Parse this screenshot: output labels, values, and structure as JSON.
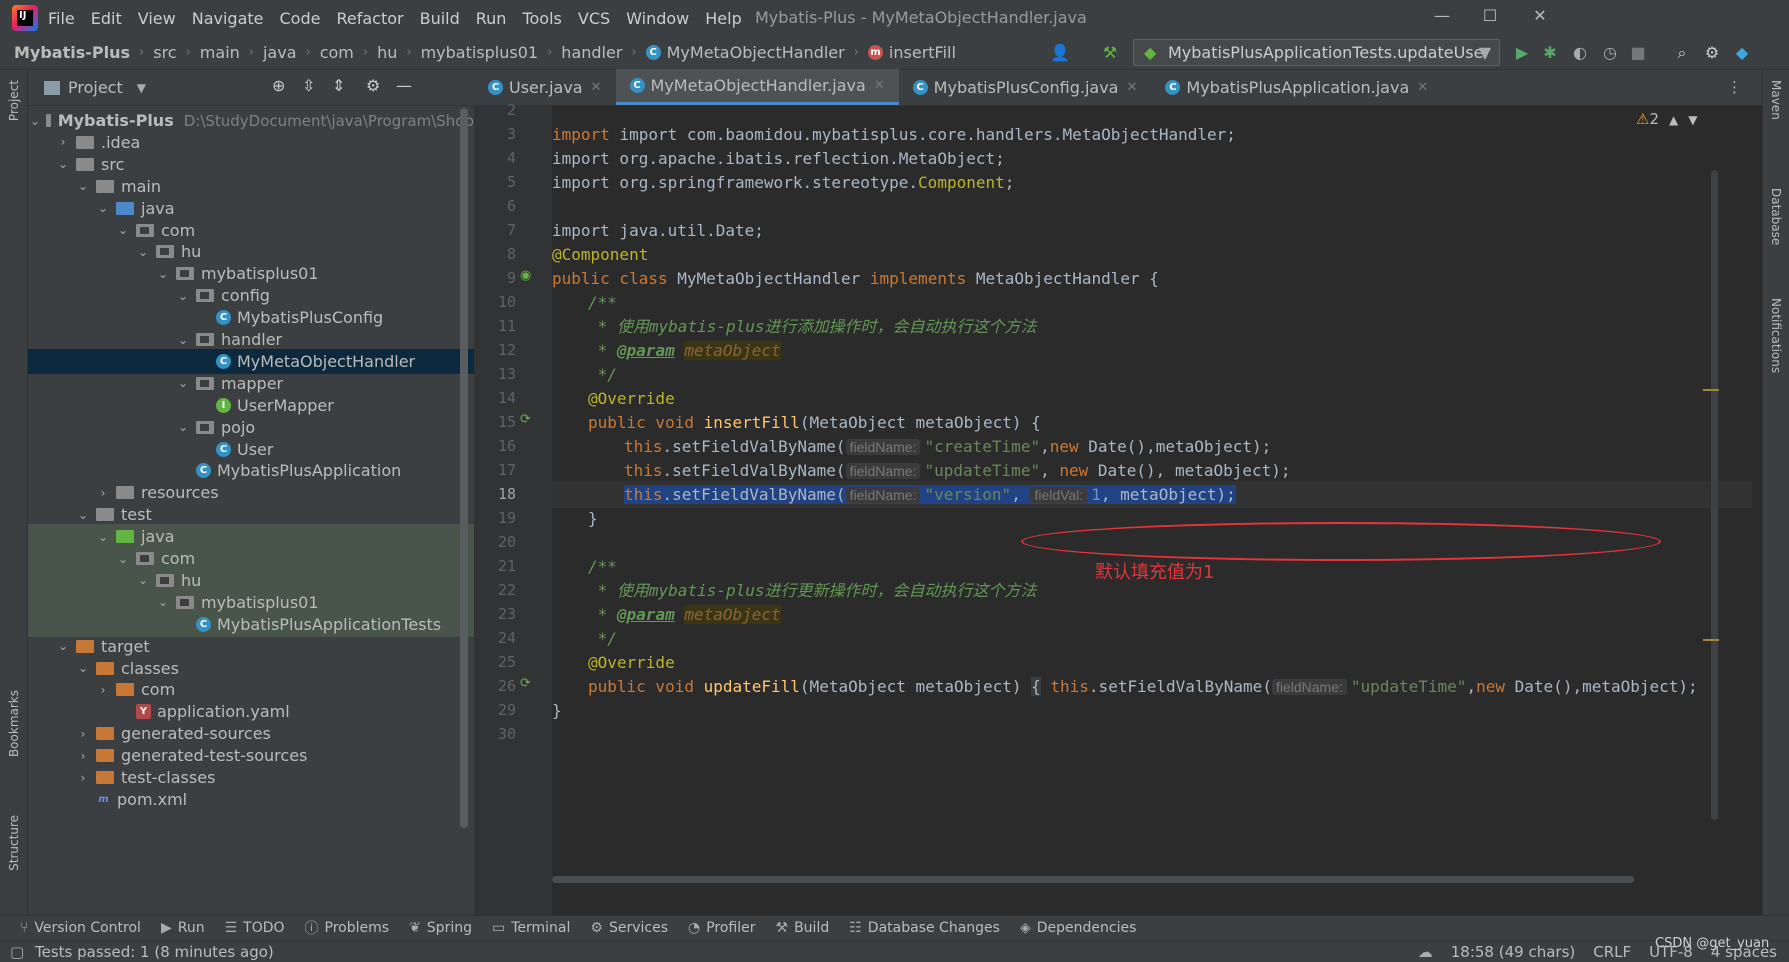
{
  "window": {
    "title": "Mybatis-Plus - MyMetaObjectHandler.java",
    "minimize": "—",
    "maximize": "☐",
    "close": "✕"
  },
  "menu": [
    "File",
    "Edit",
    "View",
    "Navigate",
    "Code",
    "Refactor",
    "Build",
    "Run",
    "Tools",
    "VCS",
    "Window",
    "Help"
  ],
  "breadcrumb": [
    "Mybatis-Plus",
    "src",
    "main",
    "java",
    "com",
    "hu",
    "mybatisplus01",
    "handler",
    "MyMetaObjectHandler",
    "insertFill"
  ],
  "run_config": "MybatisPlusApplicationTests.updateUser",
  "project_panel": {
    "title": "Project",
    "root_path": "D:\\StudyDocument\\java\\Program\\Shop"
  },
  "tree": [
    {
      "label": "Mybatis-Plus",
      "depth": 0,
      "arrow": "⌄",
      "icon": "fold gray",
      "bold": true
    },
    {
      "label": ".idea",
      "depth": 1,
      "arrow": "›",
      "icon": "fold gray"
    },
    {
      "label": "src",
      "depth": 1,
      "arrow": "⌄",
      "icon": "fold gray"
    },
    {
      "label": "main",
      "depth": 2,
      "arrow": "⌄",
      "icon": "fold gray"
    },
    {
      "label": "java",
      "depth": 3,
      "arrow": "⌄",
      "icon": "fold blue"
    },
    {
      "label": "com",
      "depth": 4,
      "arrow": "⌄",
      "icon": "fold gray pkg"
    },
    {
      "label": "hu",
      "depth": 5,
      "arrow": "⌄",
      "icon": "fold gray pkg"
    },
    {
      "label": "mybatisplus01",
      "depth": 6,
      "arrow": "⌄",
      "icon": "fold gray pkg"
    },
    {
      "label": "config",
      "depth": 7,
      "arrow": "⌄",
      "icon": "fold gray pkg"
    },
    {
      "label": "MybatisPlusConfig",
      "depth": 8,
      "arrow": "",
      "icon": "class"
    },
    {
      "label": "handler",
      "depth": 7,
      "arrow": "⌄",
      "icon": "fold gray pkg"
    },
    {
      "label": "MyMetaObjectHandler",
      "depth": 8,
      "arrow": "",
      "icon": "class",
      "selected": true
    },
    {
      "label": "mapper",
      "depth": 7,
      "arrow": "⌄",
      "icon": "fold gray pkg"
    },
    {
      "label": "UserMapper",
      "depth": 8,
      "arrow": "",
      "icon": "interface"
    },
    {
      "label": "pojo",
      "depth": 7,
      "arrow": "⌄",
      "icon": "fold gray pkg"
    },
    {
      "label": "User",
      "depth": 8,
      "arrow": "",
      "icon": "class"
    },
    {
      "label": "MybatisPlusApplication",
      "depth": 7,
      "arrow": "",
      "icon": "class"
    },
    {
      "label": "resources",
      "depth": 3,
      "arrow": "›",
      "icon": "fold gray"
    },
    {
      "label": "test",
      "depth": 2,
      "arrow": "⌄",
      "icon": "fold gray"
    },
    {
      "label": "java",
      "depth": 3,
      "arrow": "⌄",
      "icon": "fold green",
      "test": true
    },
    {
      "label": "com",
      "depth": 4,
      "arrow": "⌄",
      "icon": "fold gray pkg",
      "test": true
    },
    {
      "label": "hu",
      "depth": 5,
      "arrow": "⌄",
      "icon": "fold gray pkg",
      "test": true
    },
    {
      "label": "mybatisplus01",
      "depth": 6,
      "arrow": "⌄",
      "icon": "fold gray pkg",
      "test": true
    },
    {
      "label": "MybatisPlusApplicationTests",
      "depth": 7,
      "arrow": "",
      "icon": "class",
      "test": true
    },
    {
      "label": "target",
      "depth": 1,
      "arrow": "⌄",
      "icon": "fold orange"
    },
    {
      "label": "classes",
      "depth": 2,
      "arrow": "⌄",
      "icon": "fold orange"
    },
    {
      "label": "com",
      "depth": 3,
      "arrow": "›",
      "icon": "fold orange"
    },
    {
      "label": "application.yaml",
      "depth": 4,
      "arrow": "",
      "icon": "yaml"
    },
    {
      "label": "generated-sources",
      "depth": 2,
      "arrow": "›",
      "icon": "fold orange"
    },
    {
      "label": "generated-test-sources",
      "depth": 2,
      "arrow": "›",
      "icon": "fold orange"
    },
    {
      "label": "test-classes",
      "depth": 2,
      "arrow": "›",
      "icon": "fold orange"
    },
    {
      "label": "pom.xml",
      "depth": 2,
      "arrow": "",
      "icon": "maven"
    }
  ],
  "tabs": [
    {
      "label": "User.java",
      "active": false
    },
    {
      "label": "MyMetaObjectHandler.java",
      "active": true
    },
    {
      "label": "MybatisPlusConfig.java",
      "active": false
    },
    {
      "label": "MybatisPlusApplication.java",
      "active": false
    }
  ],
  "line_numbers": [
    "2",
    "3",
    "4",
    "5",
    "6",
    "7",
    "8",
    "9",
    "10",
    "11",
    "12",
    "13",
    "14",
    "15",
    "16",
    "17",
    "18",
    "19",
    "20",
    "21",
    "22",
    "23",
    "24",
    "25",
    "26",
    "29",
    "30"
  ],
  "current_line": "18",
  "code": {
    "l3": "import com.baomidou.mybatisplus.core.handlers.MetaObjectHandler;",
    "l4": "import org.apache.ibatis.reflection.MetaObject;",
    "l5a": "import org.springframework.stereotype.",
    "l5b": "Component",
    "l7": "import java.util.Date;",
    "l8": "@Component",
    "l9a": "public class ",
    "l9b": "MyMetaObjectHandler ",
    "l9c": "implements ",
    "l9d": "MetaObjectHandler {",
    "l10": "/**",
    "l11a": " * 使用",
    "l11b": "mybatis-plus",
    "l11c": "进行添加操作时，会自动执行这个方法",
    "l12a": " * ",
    "l12b": "@param",
    "l12c": "metaObject",
    "l13": " */",
    "l14": "@Override",
    "l15a": "public void ",
    "l15b": "insertFill",
    "l15c": "(MetaObject metaObject) {",
    "this": "this",
    "setField": ".setFieldValByName(",
    "hint_fieldName": "fieldName:",
    "hint_fieldVal": "fieldVal:",
    "l16a": "\"createTime\"",
    "l16b": ",",
    "new": "new",
    "l16c": " Date(),metaObject);",
    "l17a": "\"updateTime\"",
    "l17b": ", ",
    "l17c": " Date(), metaObject);",
    "l18a": "\"version\"",
    "l18b": ",",
    "l18c": "1",
    "l18d": ", metaObject);",
    "l19": "}",
    "l21": "/**",
    "l22a": " * 使用",
    "l22b": "mybatis-plus",
    "l22c": "进行更新操作时，会自动执行这个方法",
    "l23a": " * ",
    "l23b": "@param",
    "l23c": "metaObject",
    "l24": " */",
    "l25": "@Override",
    "l26a": "public void ",
    "l26b": "updateFill",
    "l26c": "(MetaObject metaObject) ",
    "l26d": "{",
    "l26e": "\"updateTime\"",
    "l26f": ",",
    "l26g": " Date(),metaObject);",
    "l29": "}"
  },
  "annotation": "默认填充值为1",
  "warnings": "2",
  "bottom_tools": [
    "Version Control",
    "Run",
    "TODO",
    "Problems",
    "Spring",
    "Terminal",
    "Services",
    "Profiler",
    "Build",
    "Database Changes",
    "Dependencies"
  ],
  "status": {
    "left": "Tests passed: 1 (8 minutes ago)",
    "time": "18:58 (49 chars)",
    "eol": "CRLF",
    "encoding": "UTF-8",
    "indent": "4 spaces",
    "watermark": "CSDN @get_yuan"
  },
  "side_tabs": {
    "project": "Project",
    "bookmarks": "Bookmarks",
    "structure": "Structure",
    "maven": "Maven",
    "database": "Database",
    "notifications": "Notifications"
  }
}
